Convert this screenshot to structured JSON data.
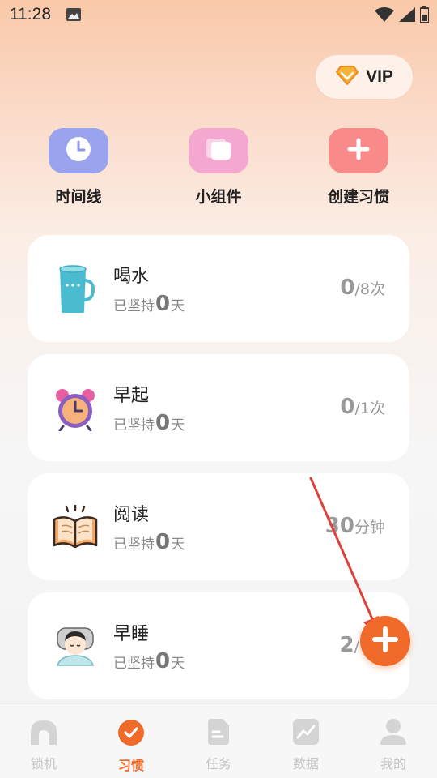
{
  "status_bar": {
    "time": "11:28",
    "icons": [
      "image-icon",
      "wifi-icon",
      "signal-icon",
      "battery-icon"
    ]
  },
  "vip": {
    "label": "VIP",
    "icon": "diamond-icon",
    "color": "#f39a2b"
  },
  "quick_actions": [
    {
      "label": "时间线",
      "icon": "clock-icon",
      "color": "#9aa4ee"
    },
    {
      "label": "小组件",
      "icon": "widget-icon",
      "color": "#f5a8cf"
    },
    {
      "label": "创建习惯",
      "icon": "plus-icon",
      "color": "#f98a8a"
    }
  ],
  "habits": [
    {
      "name": "喝水",
      "icon": "cup-icon",
      "streak_prefix": "已坚持",
      "streak_days": "0",
      "streak_suffix": "天",
      "progress_value": "0",
      "progress_unit": "/8次"
    },
    {
      "name": "早起",
      "icon": "alarm-clock-icon",
      "streak_prefix": "已坚持",
      "streak_days": "0",
      "streak_suffix": "天",
      "progress_value": "0",
      "progress_unit": "/1次"
    },
    {
      "name": "阅读",
      "icon": "book-icon",
      "streak_prefix": "已坚持",
      "streak_days": "0",
      "streak_suffix": "天",
      "progress_value": "30",
      "progress_unit": "分钟"
    },
    {
      "name": "早睡",
      "icon": "sleeper-icon",
      "streak_prefix": "已坚持",
      "streak_days": "0",
      "streak_suffix": "天",
      "progress_value": "2",
      "progress_unit": "/"
    }
  ],
  "fab": {
    "icon": "plus-icon",
    "color": "#f06a2a"
  },
  "bottom_nav": [
    {
      "label": "锁机",
      "icon": "lock-arch-icon",
      "active": false
    },
    {
      "label": "习惯",
      "icon": "check-circle-icon",
      "active": true
    },
    {
      "label": "任务",
      "icon": "task-doc-icon",
      "active": false
    },
    {
      "label": "数据",
      "icon": "chart-icon",
      "active": false
    },
    {
      "label": "我的",
      "icon": "user-icon",
      "active": false
    }
  ],
  "colors": {
    "accent": "#f06a2a",
    "annotation_arrow": "#e0403a"
  }
}
